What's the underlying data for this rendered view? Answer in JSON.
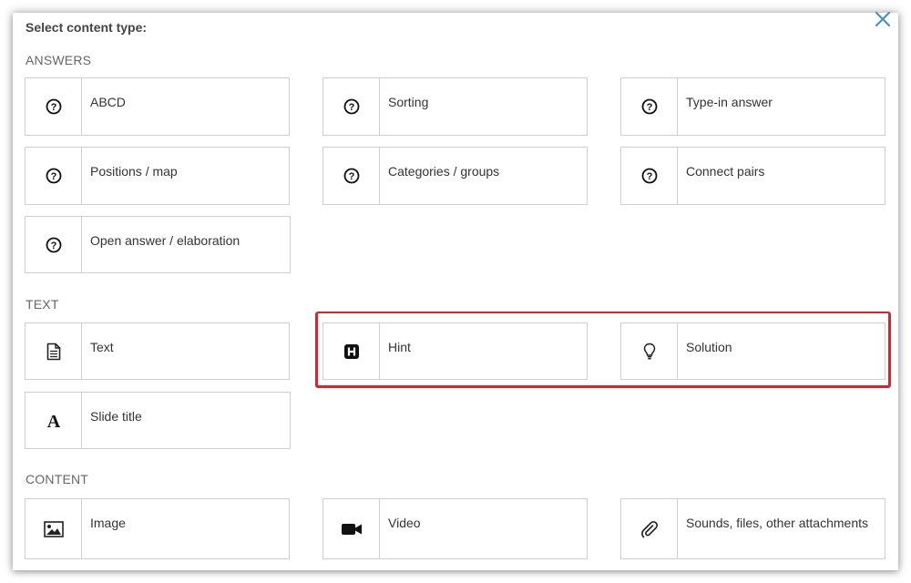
{
  "dialog": {
    "title": "Select content type:"
  },
  "sections": {
    "answers": "ANSWERS",
    "text": "TEXT",
    "content": "CONTENT"
  },
  "answers": [
    {
      "label": "ABCD",
      "icon": "question-circle-icon"
    },
    {
      "label": "Sorting",
      "icon": "question-circle-icon"
    },
    {
      "label": "Type-in answer",
      "icon": "question-circle-icon"
    },
    {
      "label": "Positions / map",
      "icon": "question-circle-icon"
    },
    {
      "label": "Categories / groups",
      "icon": "question-circle-icon"
    },
    {
      "label": "Connect pairs",
      "icon": "question-circle-icon"
    },
    {
      "label": "Open answer / elaboration",
      "icon": "question-circle-icon"
    }
  ],
  "text": [
    {
      "label": "Text",
      "icon": "document-icon"
    },
    {
      "label": "Hint",
      "icon": "h-square-icon"
    },
    {
      "label": "Solution",
      "icon": "lightbulb-icon"
    },
    {
      "label": "Slide title",
      "icon": "letter-a-icon"
    }
  ],
  "content": [
    {
      "label": "Image",
      "icon": "image-icon"
    },
    {
      "label": "Video",
      "icon": "video-camera-icon"
    },
    {
      "label": "Sounds, files, other attachments",
      "icon": "paperclip-icon"
    }
  ],
  "colors": {
    "highlight": "#d9232d",
    "close": "#4a90c8",
    "border": "#cfcfcf"
  }
}
